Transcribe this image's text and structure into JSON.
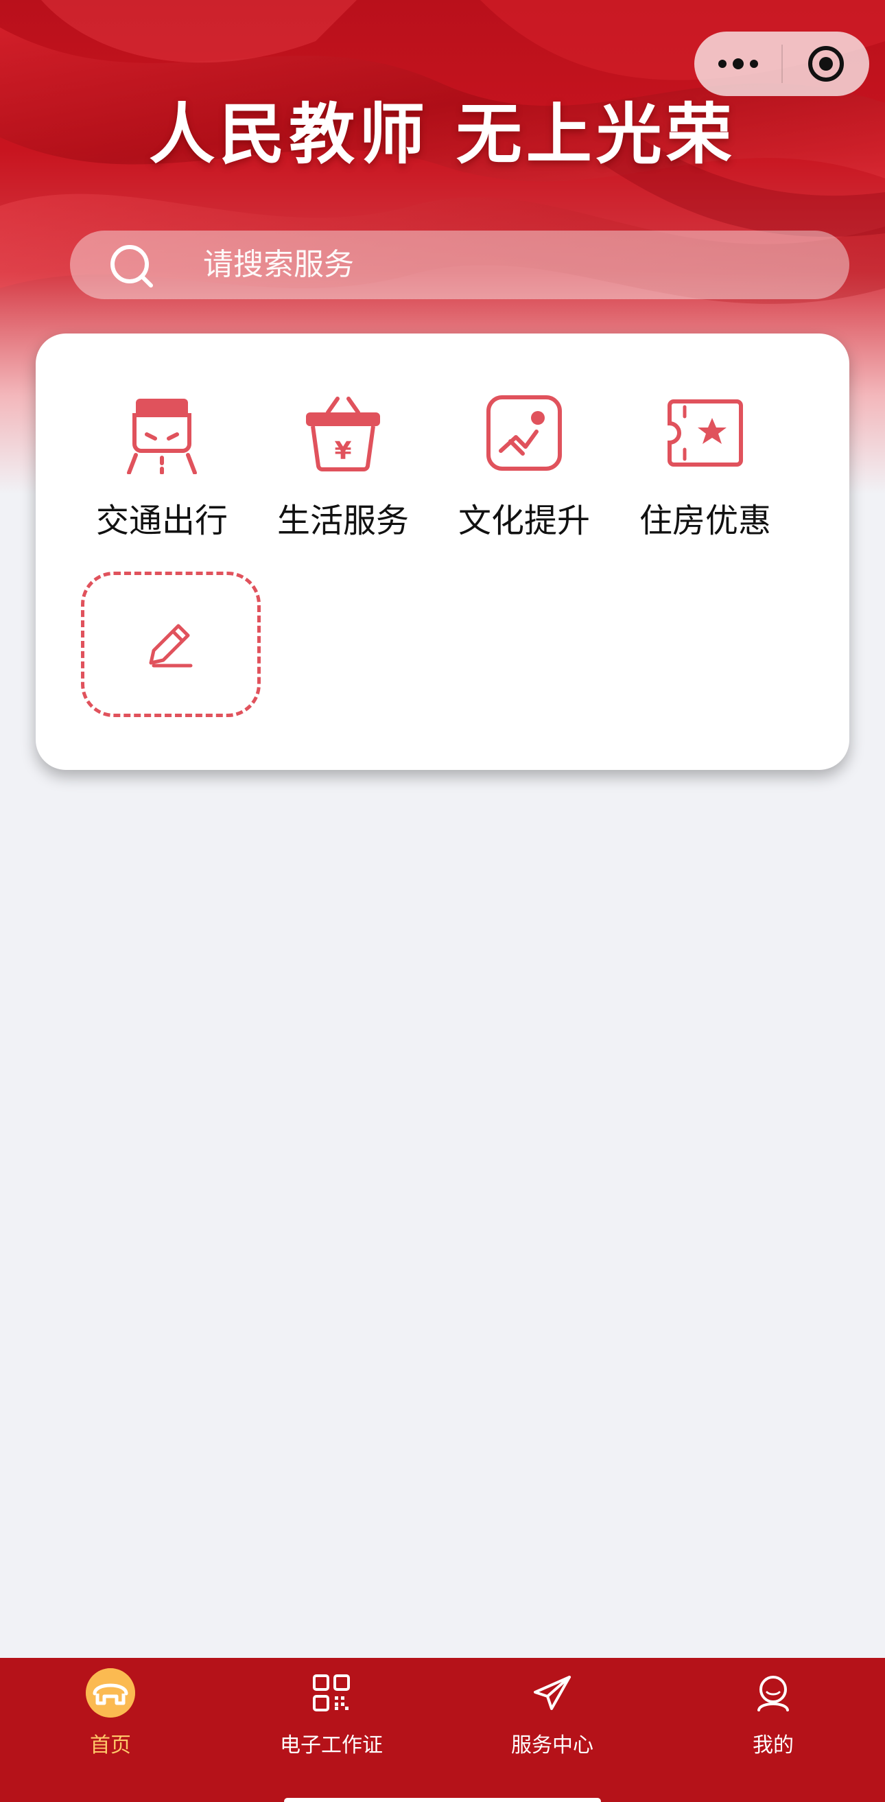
{
  "hero": {
    "title": "人民教师  无上光荣"
  },
  "capsule": {
    "more_icon": "more-dots-icon",
    "close_icon": "target-circle-icon"
  },
  "search": {
    "placeholder": "请搜索服务",
    "icon": "search-icon"
  },
  "services": [
    {
      "label": "交通出行",
      "icon": "traffic-icon"
    },
    {
      "label": "生活服务",
      "icon": "basket-yen-icon"
    },
    {
      "label": "文化提升",
      "icon": "culture-chart-icon"
    },
    {
      "label": "住房优惠",
      "icon": "ticket-star-icon"
    }
  ],
  "edit_tile": {
    "icon": "pencil-icon"
  },
  "tabbar": {
    "active_index": 0,
    "tabs": [
      {
        "label": "首页",
        "icon": "home-icon"
      },
      {
        "label": "电子工作证",
        "icon": "qrcode-icon"
      },
      {
        "label": "服务中心",
        "icon": "paper-plane-icon"
      },
      {
        "label": "我的",
        "icon": "user-icon"
      }
    ]
  },
  "colors": {
    "brand_red": "#b51219",
    "icon_red": "#e0525c",
    "active_tab": "#ffc86a",
    "page_bg": "#f1f2f6"
  }
}
